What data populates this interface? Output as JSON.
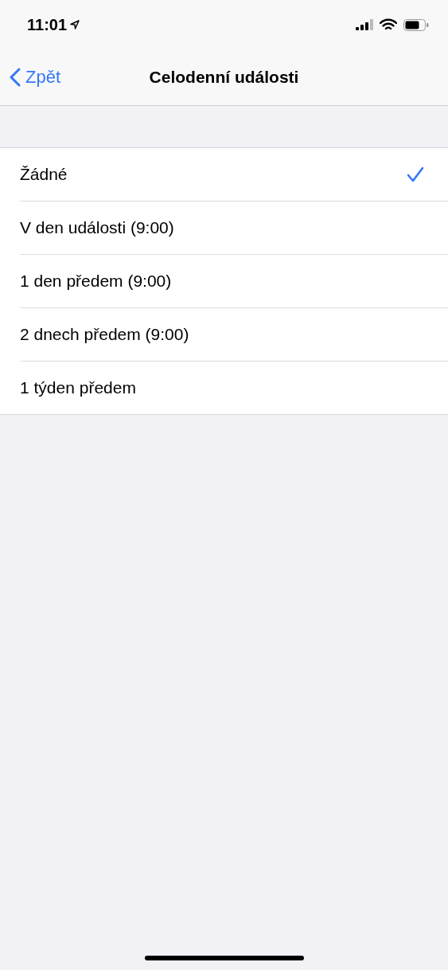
{
  "status_bar": {
    "time": "11:01"
  },
  "nav": {
    "back": "Zpět",
    "title": "Celodenní události"
  },
  "options": [
    {
      "label": "Žádné",
      "selected": true
    },
    {
      "label": "V den události (9:00)",
      "selected": false
    },
    {
      "label": "1 den předem (9:00)",
      "selected": false
    },
    {
      "label": "2 dnech předem (9:00)",
      "selected": false
    },
    {
      "label": "1 týden předem",
      "selected": false
    }
  ]
}
